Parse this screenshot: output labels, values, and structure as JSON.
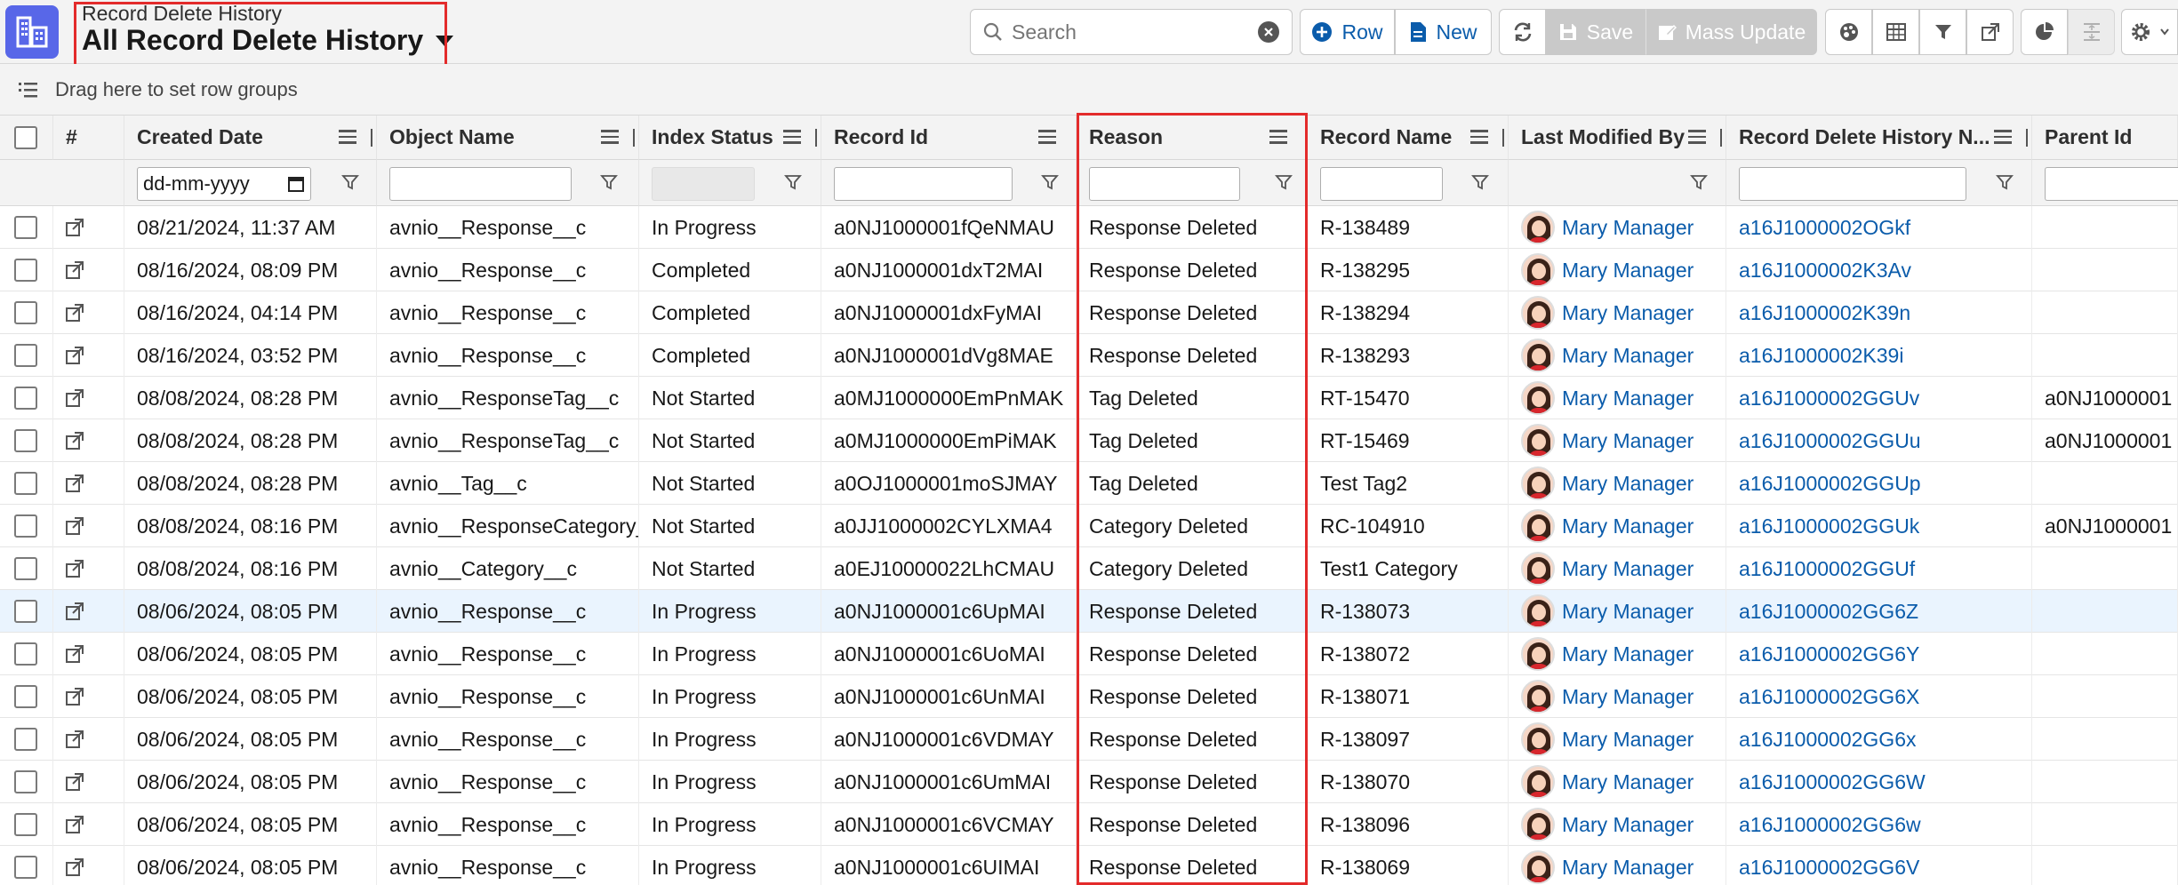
{
  "header": {
    "object_label": "Record Delete History",
    "view_name": "All Record Delete History"
  },
  "search": {
    "placeholder": "Search"
  },
  "toolbar": {
    "row_label": "Row",
    "new_label": "New",
    "save_label": "Save",
    "mass_update_label": "Mass Update"
  },
  "groupbar": {
    "text": "Drag here to set row groups"
  },
  "columns": {
    "number": "#",
    "created_date": "Created Date",
    "object_name": "Object Name",
    "index_status": "Index Status",
    "record_id": "Record Id",
    "reason": "Reason",
    "record_name": "Record Name",
    "last_modified_by": "Last Modified By",
    "rdh_name": "Record Delete History N...",
    "parent_id": "Parent Id"
  },
  "filters": {
    "date_placeholder": "dd-mm-yyyy"
  },
  "colors": {
    "accent": "#0b5cab",
    "app_icon": "#5867e8",
    "highlight": "#e32b2b",
    "selected_row": "#eaf4fe"
  },
  "rows": [
    {
      "created": "08/21/2024, 11:37 AM",
      "object": "avnio__Response__c",
      "status": "In Progress",
      "record_id": "a0NJ1000001fQeNMAU",
      "reason": "Response Deleted",
      "record_name": "R-138489",
      "modified_by": "Mary Manager",
      "rdh_name": "a16J1000002OGkf",
      "parent": ""
    },
    {
      "created": "08/16/2024, 08:09 PM",
      "object": "avnio__Response__c",
      "status": "Completed",
      "record_id": "a0NJ1000001dxT2MAI",
      "reason": "Response Deleted",
      "record_name": "R-138295",
      "modified_by": "Mary Manager",
      "rdh_name": "a16J1000002K3Av",
      "parent": ""
    },
    {
      "created": "08/16/2024, 04:14 PM",
      "object": "avnio__Response__c",
      "status": "Completed",
      "record_id": "a0NJ1000001dxFyMAI",
      "reason": "Response Deleted",
      "record_name": "R-138294",
      "modified_by": "Mary Manager",
      "rdh_name": "a16J1000002K39n",
      "parent": ""
    },
    {
      "created": "08/16/2024, 03:52 PM",
      "object": "avnio__Response__c",
      "status": "Completed",
      "record_id": "a0NJ1000001dVg8MAE",
      "reason": "Response Deleted",
      "record_name": "R-138293",
      "modified_by": "Mary Manager",
      "rdh_name": "a16J1000002K39i",
      "parent": ""
    },
    {
      "created": "08/08/2024, 08:28 PM",
      "object": "avnio__ResponseTag__c",
      "status": "Not Started",
      "record_id": "a0MJ1000000EmPnMAK",
      "reason": "Tag Deleted",
      "record_name": "RT-15470",
      "modified_by": "Mary Manager",
      "rdh_name": "a16J1000002GGUv",
      "parent": "a0NJ1000001"
    },
    {
      "created": "08/08/2024, 08:28 PM",
      "object": "avnio__ResponseTag__c",
      "status": "Not Started",
      "record_id": "a0MJ1000000EmPiMAK",
      "reason": "Tag Deleted",
      "record_name": "RT-15469",
      "modified_by": "Mary Manager",
      "rdh_name": "a16J1000002GGUu",
      "parent": "a0NJ1000001"
    },
    {
      "created": "08/08/2024, 08:28 PM",
      "object": "avnio__Tag__c",
      "status": "Not Started",
      "record_id": "a0OJ1000001moSJMAY",
      "reason": "Tag Deleted",
      "record_name": "Test Tag2",
      "modified_by": "Mary Manager",
      "rdh_name": "a16J1000002GGUp",
      "parent": ""
    },
    {
      "created": "08/08/2024, 08:16 PM",
      "object": "avnio__ResponseCategory_",
      "status": "Not Started",
      "record_id": "a0JJ1000002CYLXMA4",
      "reason": "Category Deleted",
      "record_name": "RC-104910",
      "modified_by": "Mary Manager",
      "rdh_name": "a16J1000002GGUk",
      "parent": "a0NJ1000001"
    },
    {
      "created": "08/08/2024, 08:16 PM",
      "object": "avnio__Category__c",
      "status": "Not Started",
      "record_id": "a0EJ10000022LhCMAU",
      "reason": "Category Deleted",
      "record_name": "Test1 Category",
      "modified_by": "Mary Manager",
      "rdh_name": "a16J1000002GGUf",
      "parent": ""
    },
    {
      "created": "08/06/2024, 08:05 PM",
      "object": "avnio__Response__c",
      "status": "In Progress",
      "record_id": "a0NJ1000001c6UpMAI",
      "reason": "Response Deleted",
      "record_name": "R-138073",
      "modified_by": "Mary Manager",
      "rdh_name": "a16J1000002GG6Z",
      "parent": ""
    },
    {
      "created": "08/06/2024, 08:05 PM",
      "object": "avnio__Response__c",
      "status": "In Progress",
      "record_id": "a0NJ1000001c6UoMAI",
      "reason": "Response Deleted",
      "record_name": "R-138072",
      "modified_by": "Mary Manager",
      "rdh_name": "a16J1000002GG6Y",
      "parent": ""
    },
    {
      "created": "08/06/2024, 08:05 PM",
      "object": "avnio__Response__c",
      "status": "In Progress",
      "record_id": "a0NJ1000001c6UnMAI",
      "reason": "Response Deleted",
      "record_name": "R-138071",
      "modified_by": "Mary Manager",
      "rdh_name": "a16J1000002GG6X",
      "parent": ""
    },
    {
      "created": "08/06/2024, 08:05 PM",
      "object": "avnio__Response__c",
      "status": "In Progress",
      "record_id": "a0NJ1000001c6VDMAY",
      "reason": "Response Deleted",
      "record_name": "R-138097",
      "modified_by": "Mary Manager",
      "rdh_name": "a16J1000002GG6x",
      "parent": ""
    },
    {
      "created": "08/06/2024, 08:05 PM",
      "object": "avnio__Response__c",
      "status": "In Progress",
      "record_id": "a0NJ1000001c6UmMAI",
      "reason": "Response Deleted",
      "record_name": "R-138070",
      "modified_by": "Mary Manager",
      "rdh_name": "a16J1000002GG6W",
      "parent": ""
    },
    {
      "created": "08/06/2024, 08:05 PM",
      "object": "avnio__Response__c",
      "status": "In Progress",
      "record_id": "a0NJ1000001c6VCMAY",
      "reason": "Response Deleted",
      "record_name": "R-138096",
      "modified_by": "Mary Manager",
      "rdh_name": "a16J1000002GG6w",
      "parent": ""
    },
    {
      "created": "08/06/2024, 08:05 PM",
      "object": "avnio__Response__c",
      "status": "In Progress",
      "record_id": "a0NJ1000001c6UIMAI",
      "reason": "Response Deleted",
      "record_name": "R-138069",
      "modified_by": "Mary Manager",
      "rdh_name": "a16J1000002GG6V",
      "parent": ""
    }
  ]
}
